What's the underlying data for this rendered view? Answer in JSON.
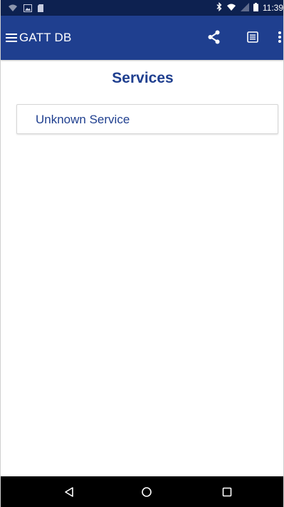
{
  "status_bar": {
    "time": "11:39",
    "left_icons": [
      "wifi-question-icon",
      "image-icon",
      "sd-card-icon"
    ],
    "right_icons": [
      "bluetooth-icon",
      "wifi-icon",
      "signal-icon",
      "battery-icon"
    ]
  },
  "app_bar": {
    "title": "GATT DB",
    "actions": [
      "menu-icon",
      "share-icon",
      "list-view-icon",
      "more-vert-icon"
    ]
  },
  "main": {
    "title": "Services",
    "services": [
      "Unknown Service"
    ]
  },
  "nav_bar": {
    "buttons": [
      "back-icon",
      "home-icon",
      "recent-apps-icon"
    ]
  },
  "colors": {
    "status_bar_bg": "#0d2150",
    "app_bar_bg": "#1f3f8f",
    "accent_text": "#1f3f8f",
    "nav_bar_bg": "#000000",
    "card_border": "#d6d6d6"
  }
}
